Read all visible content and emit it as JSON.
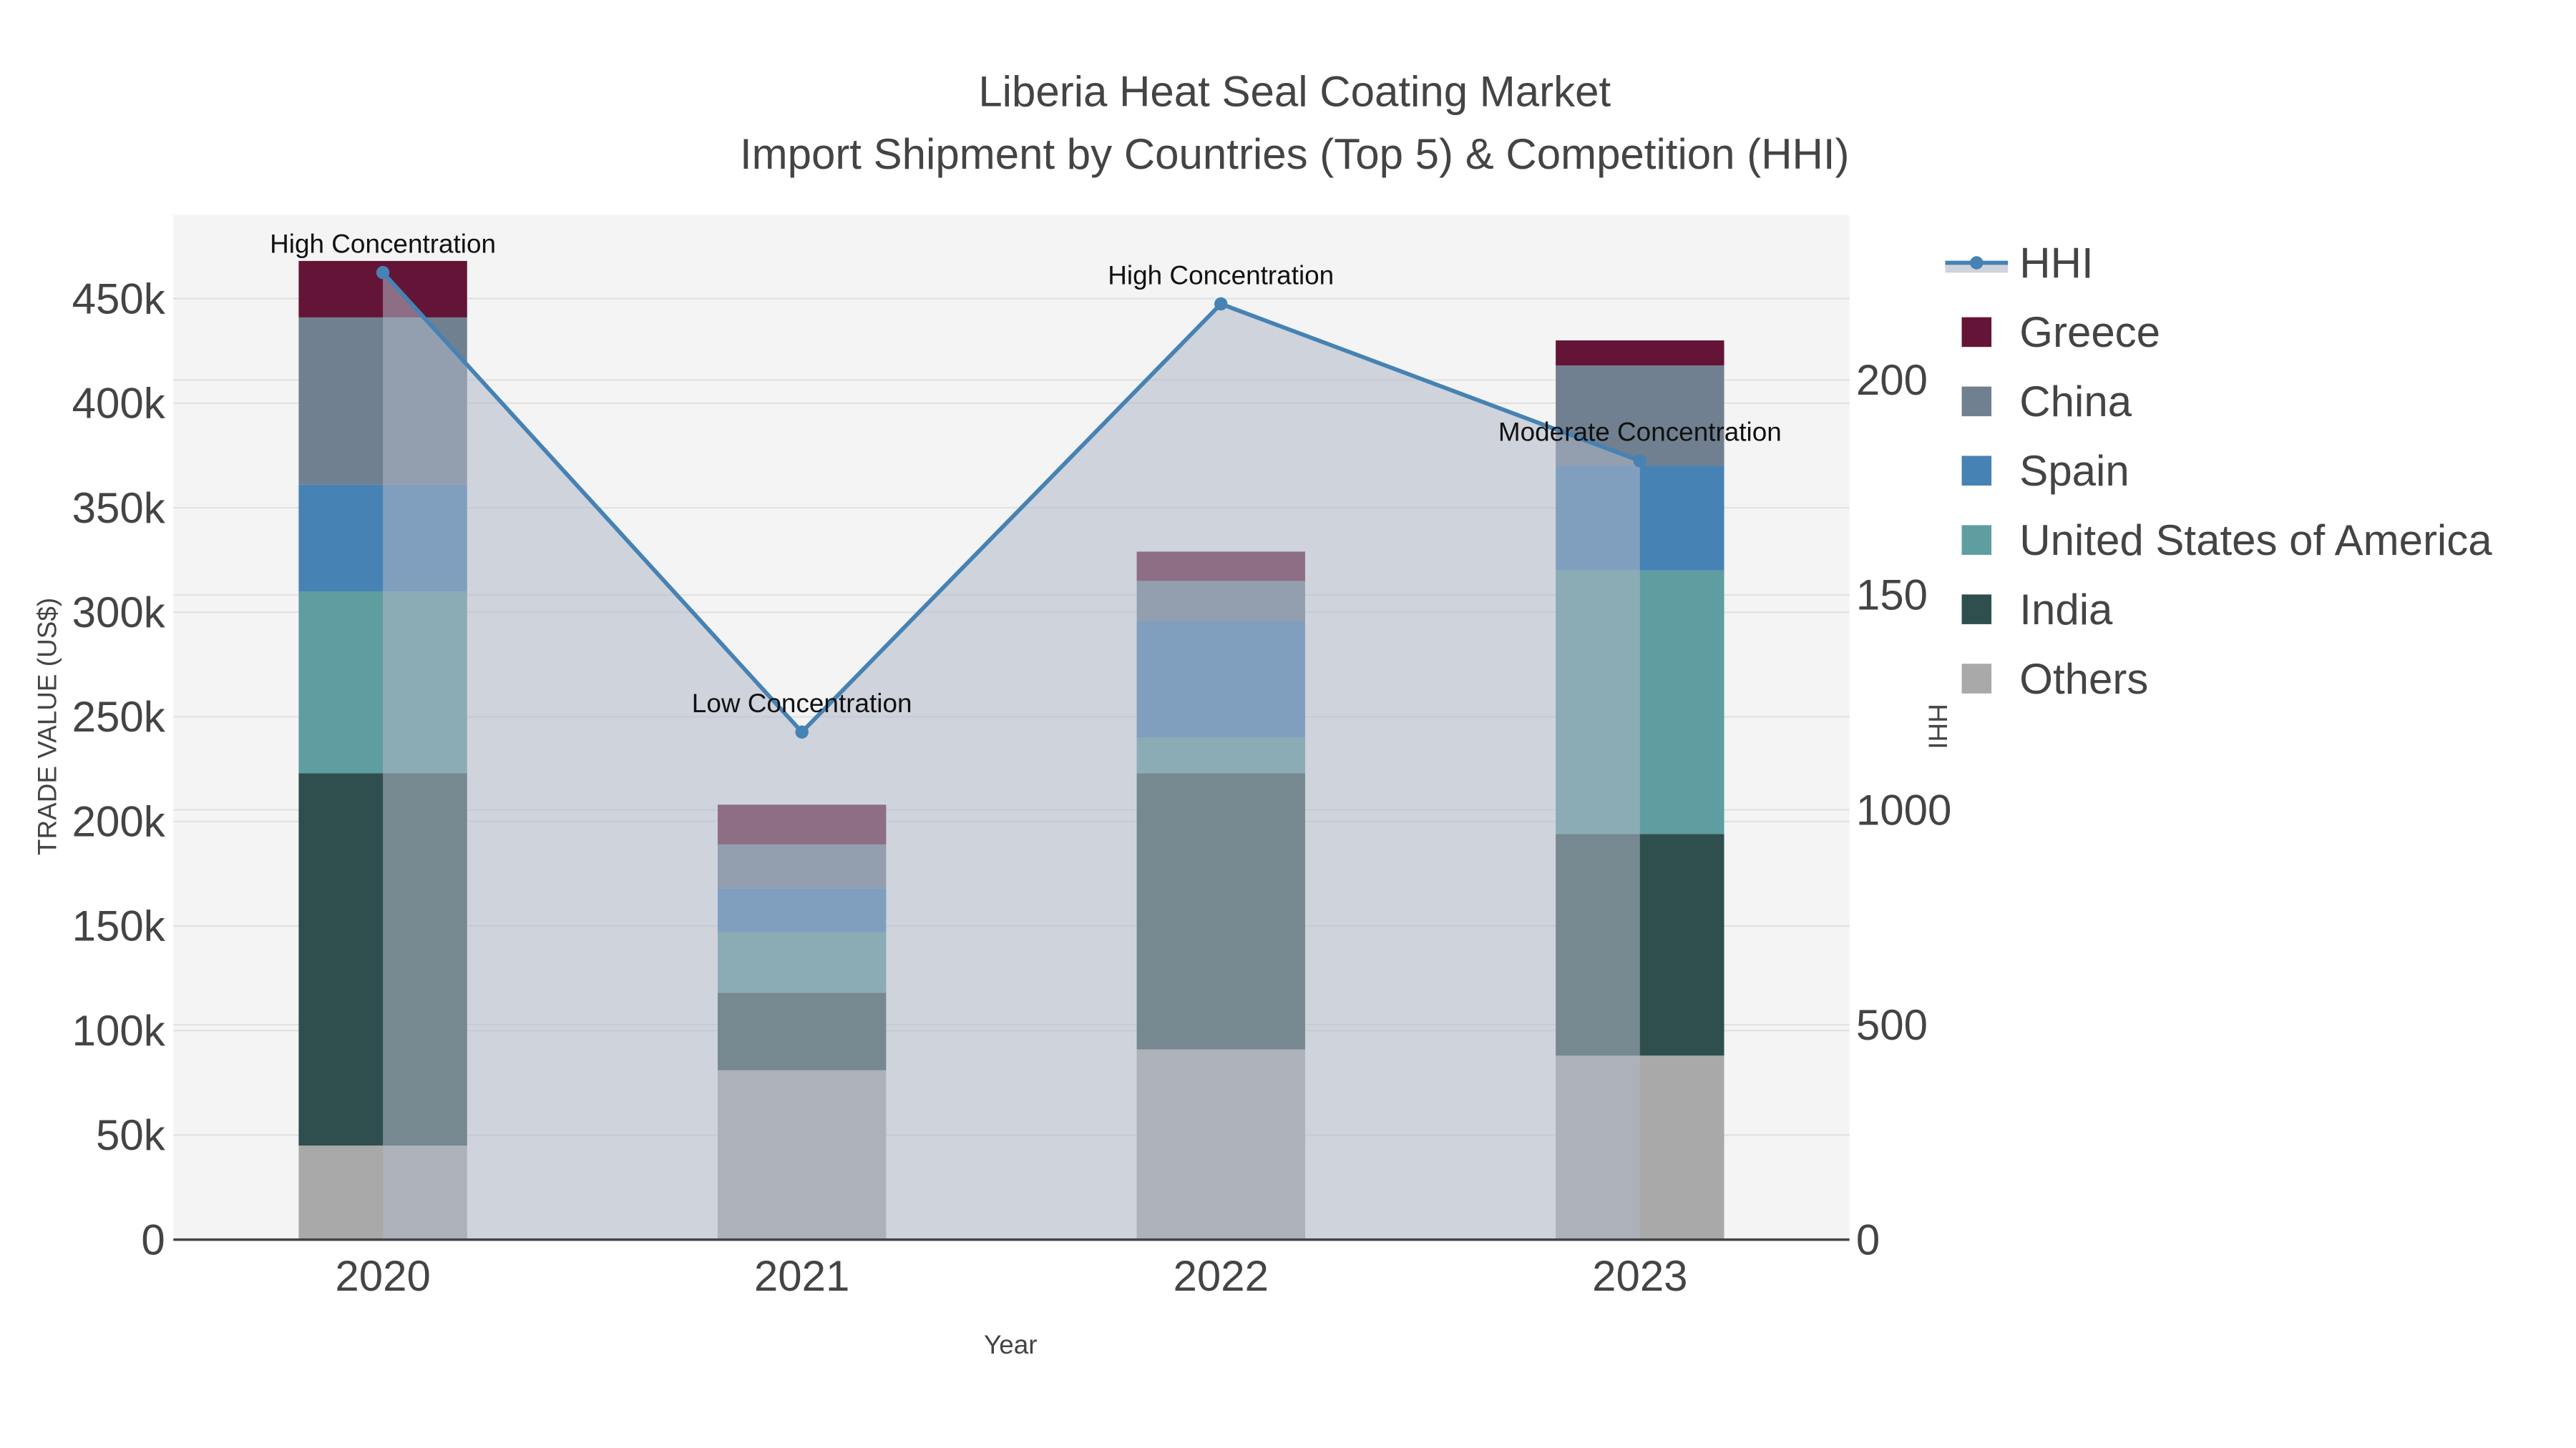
{
  "chart_data": {
    "type": "bar",
    "stacked": true,
    "title": "Liberia Heat Seal Coating Market",
    "subtitle": "Import Shipment by Countries (Top 5) & Competition (HHI)",
    "xlabel": "Year",
    "ylabel": "TRADE VALUE (US$)",
    "y2label": "HHI",
    "categories": [
      "2020",
      "2021",
      "2022",
      "2023"
    ],
    "ylim": [
      0,
      490000
    ],
    "yticks": [
      0,
      50000,
      100000,
      150000,
      200000,
      250000,
      300000,
      350000,
      400000,
      450000
    ],
    "ytick_labels": [
      "0",
      "50k",
      "100k",
      "150k",
      "200k",
      "250k",
      "300k",
      "350k",
      "400k",
      "450k"
    ],
    "y2ticks": [
      0,
      500,
      1000,
      1500,
      2000
    ],
    "y2tick_labels": [
      "0",
      "500",
      "1000",
      "150",
      "200"
    ],
    "y2lim": [
      0,
      2384
    ],
    "grid": true,
    "legend_position": "right",
    "series": [
      {
        "name": "Others",
        "color": "#a9a9a9",
        "values": [
          45000,
          81000,
          91000,
          88000
        ]
      },
      {
        "name": "India",
        "color": "#2f4f4f",
        "values": [
          178000,
          37000,
          132000,
          106000
        ]
      },
      {
        "name": "United States of America",
        "color": "#5f9ea0",
        "values": [
          87000,
          29000,
          17000,
          126000
        ]
      },
      {
        "name": "Spain",
        "color": "#4682b4",
        "values": [
          51000,
          21000,
          56000,
          50000
        ]
      },
      {
        "name": "China",
        "color": "#708090",
        "values": [
          80000,
          21000,
          19000,
          48000
        ]
      },
      {
        "name": "Greece",
        "color": "#641436",
        "values": [
          27000,
          19000,
          14000,
          12000
        ]
      }
    ],
    "line": {
      "name": "HHI",
      "color": "#4682b4",
      "values": [
        2250,
        1181,
        2177,
        1812
      ]
    },
    "annotations": [
      "High Concentration",
      "Low Concentration",
      "High Concentration",
      "Moderate Concentration"
    ]
  }
}
